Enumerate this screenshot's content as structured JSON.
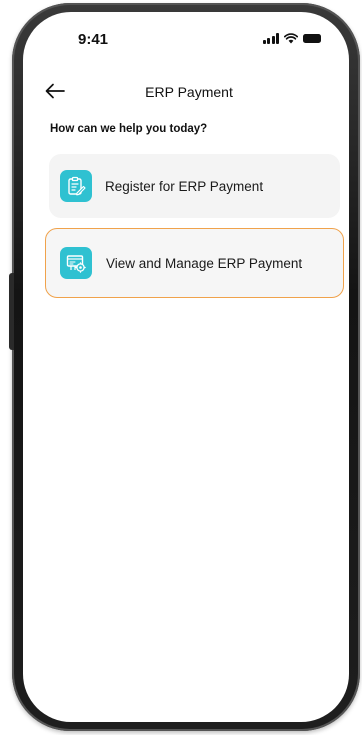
{
  "status_bar": {
    "time": "9:41"
  },
  "header": {
    "title": "ERP Payment"
  },
  "prompt": "How can we help you today?",
  "options": [
    {
      "label": "Register for ERP Payment",
      "icon": "clipboard-edit-icon"
    },
    {
      "label": "View and Manage ERP Payment",
      "icon": "erp-card-gear-icon"
    }
  ],
  "colors": {
    "accent_teal": "#2fc1d1",
    "selected_border": "#f0a24b",
    "card_background": "#f4f4f4"
  }
}
